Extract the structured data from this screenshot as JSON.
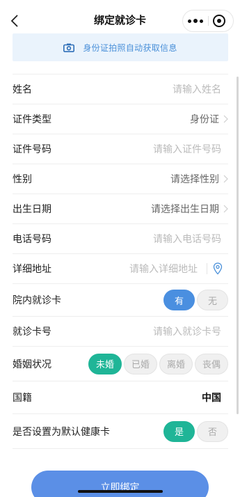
{
  "nav": {
    "title": "绑定就诊卡",
    "back_icon": "chevron-left-icon"
  },
  "banner": {
    "text": "身份证拍照自动获取信息",
    "icon": "camera-icon",
    "color": "#4a90d9"
  },
  "fields": {
    "name": {
      "label": "姓名",
      "placeholder": "请输入姓名"
    },
    "id_type": {
      "label": "证件类型",
      "value": "身份证"
    },
    "id_number": {
      "label": "证件号码",
      "placeholder": "请输入证件号码"
    },
    "gender": {
      "label": "性别",
      "placeholder": "请选择性别"
    },
    "birthdate": {
      "label": "出生日期",
      "placeholder": "请选择出生日期"
    },
    "phone": {
      "label": "电话号码",
      "placeholder": "请输入电话号码"
    },
    "address": {
      "label": "详细地址",
      "placeholder": "请输入详细地址"
    },
    "has_card": {
      "label": "院内就诊卡",
      "options": [
        "有",
        "无"
      ],
      "selected": "有"
    },
    "card_number": {
      "label": "就诊卡号",
      "placeholder": "请输入就诊卡号"
    },
    "marital": {
      "label": "婚姻状况",
      "options": [
        "未婚",
        "已婚",
        "离婚",
        "丧偶"
      ],
      "selected": "未婚"
    },
    "nationality": {
      "label": "国籍",
      "value": "中国"
    },
    "default_card": {
      "label": "是否设置为默认健康卡",
      "options": [
        "是",
        "否"
      ],
      "selected": "是"
    }
  },
  "submit_label": "立即绑定",
  "colors": {
    "primary_blue": "#4a8fe0",
    "primary_green": "#1fb597",
    "submit": "#5b8fe6"
  }
}
